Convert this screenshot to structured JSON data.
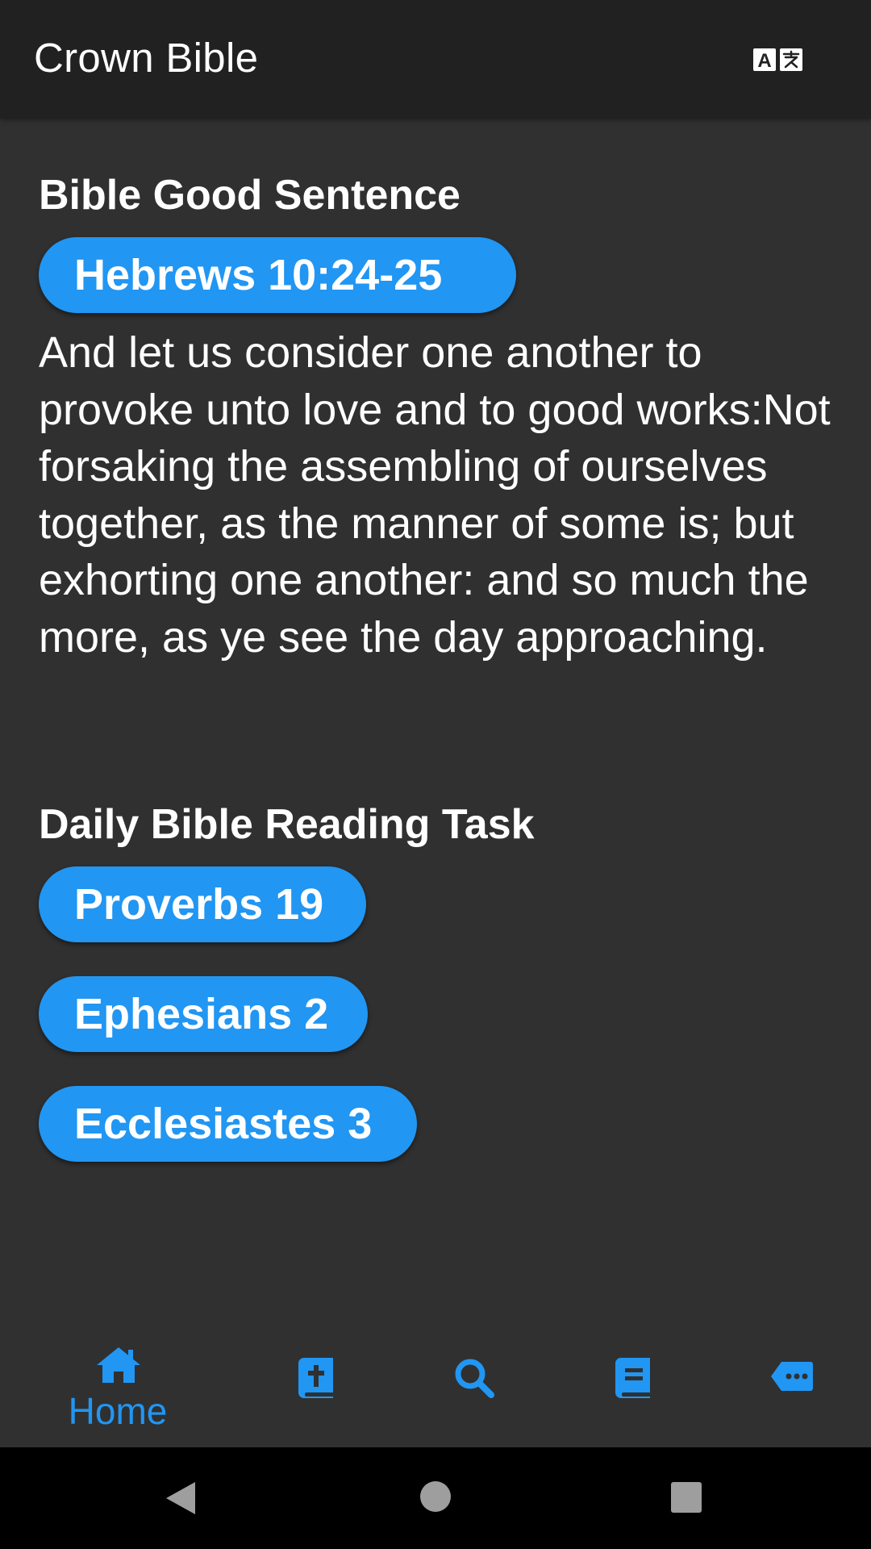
{
  "app": {
    "title": "Crown Bible",
    "translate_icon": "translate-icon"
  },
  "good_sentence": {
    "heading": "Bible Good Sentence",
    "reference": "Hebrews 10:24-25",
    "text": "And let us consider one another to provoke unto love and to good works:Not forsaking the assembling of ourselves together, as the manner of some is; but exhorting one another: and so much the more, as ye see the day approaching."
  },
  "daily_task": {
    "heading": "Daily Bible Reading Task",
    "items": [
      {
        "label": "Proverbs 19"
      },
      {
        "label": "Ephesians 2"
      },
      {
        "label": "Ecclesiastes 3"
      }
    ]
  },
  "bottom_nav": {
    "items": [
      {
        "icon": "home-icon",
        "label": "Home",
        "selected": true
      },
      {
        "icon": "bible-book-icon",
        "label": ""
      },
      {
        "icon": "search-icon",
        "label": ""
      },
      {
        "icon": "book-icon",
        "label": ""
      },
      {
        "icon": "more-tag-icon",
        "label": ""
      }
    ]
  },
  "colors": {
    "accent": "#2196f3",
    "background": "#303030",
    "topbar": "#212121",
    "system_nav": "#000000"
  }
}
